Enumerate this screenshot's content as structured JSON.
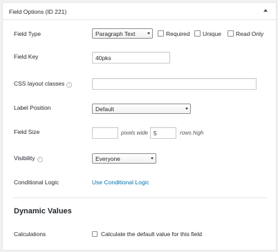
{
  "header": {
    "title": "Field Options (ID 221)",
    "toggle_icon": "triangle-up-icon"
  },
  "fields": {
    "field_type": {
      "label": "Field Type",
      "value": "Paragraph Text",
      "options": [
        {
          "label": "Required",
          "checked": false
        },
        {
          "label": "Unique",
          "checked": false
        },
        {
          "label": "Read Only",
          "checked": false
        }
      ]
    },
    "field_key": {
      "label": "Field Key",
      "value": "40pks"
    },
    "css_classes": {
      "label": "CSS layout classes",
      "value": "",
      "help_icon": "info-icon"
    },
    "label_position": {
      "label": "Label Position",
      "value": "Default"
    },
    "field_size": {
      "label": "Field Size",
      "width_value": "",
      "width_unit": "pixels wide",
      "rows_value": "5",
      "rows_unit": "rows high"
    },
    "visibility": {
      "label": "Visibility",
      "value": "Everyone",
      "help_icon": "info-icon"
    },
    "conditional_logic": {
      "label": "Conditional Logic",
      "link": "Use Conditional Logic"
    }
  },
  "dynamic_values": {
    "title": "Dynamic Values",
    "calculations": {
      "label": "Calculations",
      "checkbox_label": "Calculate the default value for this field",
      "checked": false
    }
  },
  "colors": {
    "link": "#0073aa",
    "border": "#e5e5e5"
  }
}
